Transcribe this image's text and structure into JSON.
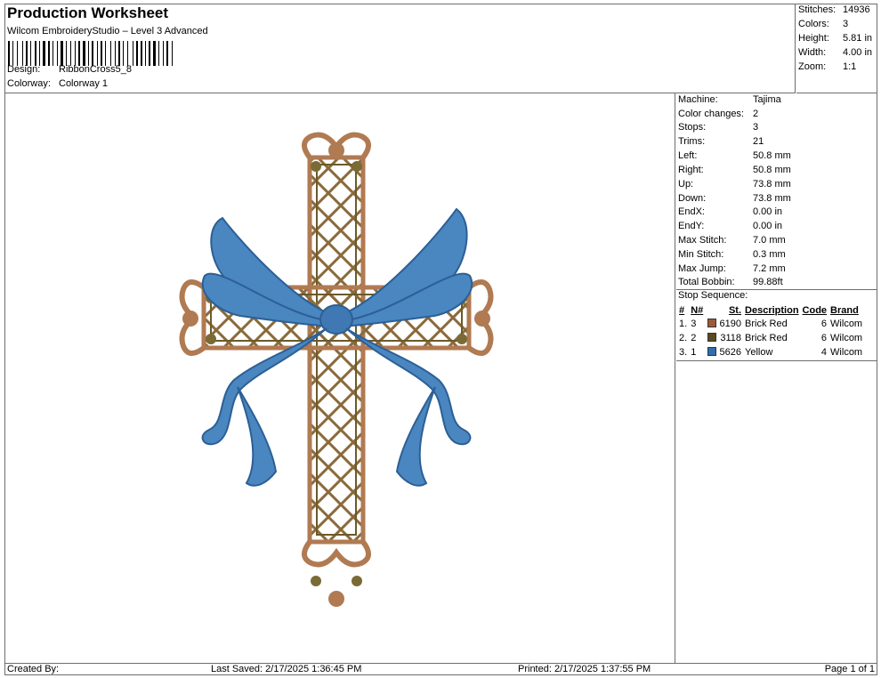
{
  "header": {
    "title": "Production Worksheet",
    "subtitle": "Wilcom EmbroideryStudio – Level 3 Advanced",
    "design_label": "Design:",
    "design_value": "RibbonCross5_8",
    "colorway_label": "Colorway:",
    "colorway_value": "Colorway 1"
  },
  "summary": [
    {
      "label": "Stitches:",
      "value": "14936"
    },
    {
      "label": "Colors:",
      "value": "3"
    },
    {
      "label": "Height:",
      "value": "5.81 in"
    },
    {
      "label": "Width:",
      "value": "4.00 in"
    },
    {
      "label": "Zoom:",
      "value": "1:1"
    }
  ],
  "info": [
    {
      "label": "Machine:",
      "value": "Tajima"
    },
    {
      "label": "Color changes:",
      "value": "2"
    },
    {
      "label": "Stops:",
      "value": "3"
    },
    {
      "label": "Trims:",
      "value": "21"
    },
    {
      "label": "Left:",
      "value": "50.8 mm"
    },
    {
      "label": "Right:",
      "value": "50.8 mm"
    },
    {
      "label": "Up:",
      "value": "73.8 mm"
    },
    {
      "label": "Down:",
      "value": "73.8 mm"
    },
    {
      "label": "EndX:",
      "value": "0.00 in"
    },
    {
      "label": "EndY:",
      "value": "0.00 in"
    },
    {
      "label": "Max Stitch:",
      "value": "7.0 mm"
    },
    {
      "label": "Min Stitch:",
      "value": "0.3 mm"
    },
    {
      "label": "Max Jump:",
      "value": "7.2 mm"
    },
    {
      "label": "Total Bobbin:",
      "value": "99.88ft"
    }
  ],
  "stop_sequence": {
    "title": "Stop Sequence:",
    "headers": [
      "#",
      "N#",
      "St.",
      "Description",
      "Code",
      "Brand"
    ],
    "rows": [
      {
        "num": "1.",
        "n": "3",
        "color": "#9b5a3a",
        "st": "6190",
        "description": "Brick Red",
        "code": "6",
        "brand": "Wilcom"
      },
      {
        "num": "2.",
        "n": "2",
        "color": "#5a4a20",
        "st": "3118",
        "description": "Brick Red",
        "code": "6",
        "brand": "Wilcom"
      },
      {
        "num": "3.",
        "n": "1",
        "color": "#2f6db0",
        "st": "5626",
        "description": "Yellow",
        "code": "4",
        "brand": "Wilcom"
      }
    ]
  },
  "footer": {
    "created_by": "Created By:",
    "last_saved": "Last Saved: 2/17/2025 1:36:45 PM",
    "printed": "Printed: 2/17/2025 1:37:55 PM",
    "page": "Page 1 of 1"
  },
  "colors": {
    "cross_tan": "#b07a52",
    "cross_dark": "#6b5a2a",
    "ribbon_blue": "#4a86c0",
    "ribbon_dark": "#2c5f95"
  },
  "icons": {
    "design_preview": "embroidery-ribbon-cross"
  }
}
